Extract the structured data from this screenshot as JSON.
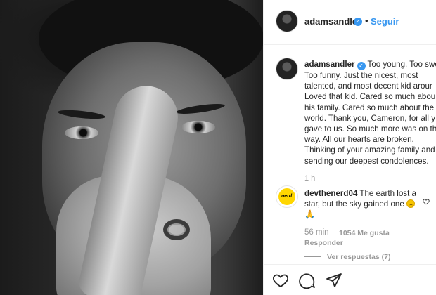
{
  "post": {
    "username": "adamsandler",
    "separator": "•",
    "follow_label": "Seguir",
    "caption_lines": [
      "Too young. Too swe",
      "Too funny. Just the nicest, most",
      "talented, and most decent kid arour",
      "Loved that kid. Cared so much abou",
      "his family. Cared so much about the",
      "world. Thank you, Cameron, for all y",
      "gave to us. So much more was on th",
      "way. All our hearts are broken.",
      "Thinking of your amazing family and",
      "sending our deepest condolences."
    ],
    "caption_time": "1 h"
  },
  "comment": {
    "username": "devthenerd04",
    "text_line1": "The earth lost a",
    "text_line2": "star, but the sky gained one",
    "avatar_label": "nerd",
    "time": "56 min",
    "likes": "1054 Me gusta",
    "reply_label": "Responder",
    "view_replies": "Ver respuestas (7)"
  },
  "icons": {
    "verified": "verified-badge-icon",
    "like": "heart-icon",
    "comment": "comment-icon",
    "share": "share-icon"
  },
  "colors": {
    "accent": "#3897f0",
    "muted": "#999999",
    "text": "#262626"
  }
}
